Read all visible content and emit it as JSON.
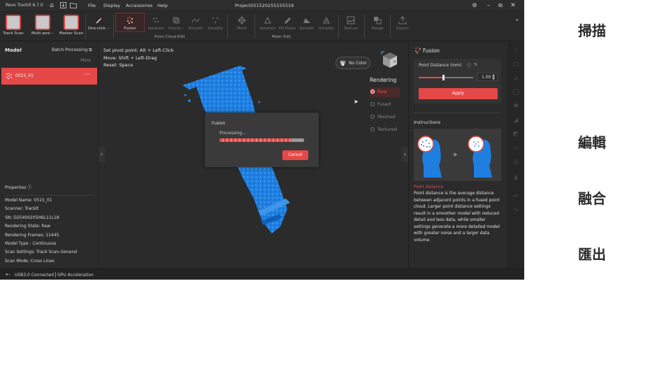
{
  "app": {
    "title": "Revo TrackIt 6.7.0",
    "project": "Project051520255155519"
  },
  "menu": [
    "File",
    "Display",
    "Accessories",
    "Help"
  ],
  "toolbar": {
    "buttons": {
      "track_scan": "Track Scan",
      "multi_pos": "Multi-posi···",
      "marker_scan": "Marker Scan",
      "one_click": "One-click ···",
      "fusion": "Fusion",
      "isolation1": "Isolation",
      "overlap": "Overla···",
      "smooth1": "Smooth",
      "simplify1": "Simplify",
      "mesh": "Mesh",
      "isolation2": "Isolation",
      "fill_holes": "Fill Holes",
      "smooth2": "Smooth",
      "simplify2": "Simplify",
      "texture": "Texture",
      "merge": "Merge",
      "export": "Export"
    },
    "groups": {
      "point_cloud_edit": "Point Cloud Edit",
      "mesh_edit": "Mesh Edit"
    }
  },
  "left_panel": {
    "title": "Model",
    "batch": "Batch Processing",
    "more": "More",
    "model_name": "0515_01",
    "properties_title": "Properties",
    "properties": [
      "Model Name:  0515_01",
      "Scanner:  TrackIt",
      "SN:  D25400205H6L11L18",
      "Rendering State:  Raw",
      "Rendering Frames:  11445",
      "Model Type :  Continuous",
      "Scan Settings:  Track Scan-General",
      "Scan Mode:  Cross Lines"
    ]
  },
  "viewport": {
    "hints": [
      "Set pivot point:  Alt + Left-Click",
      "Move:  Shift + Left-Drag",
      "Reset:  Space"
    ],
    "no_color": "No Color",
    "rendering_title": "Rendering",
    "rendering_options": [
      "Raw",
      "Fused",
      "Meshed",
      "Textured"
    ],
    "rendering_selected": "Raw"
  },
  "dialog": {
    "title": "Fusion",
    "status": "Processing...",
    "progress": 0.85,
    "cancel": "Cancel"
  },
  "right_panel": {
    "title": "Fusion",
    "point_distance_label": "Point Distance (mm)",
    "point_distance_value": "1.00",
    "slider_fraction": 0.45,
    "apply": "Apply",
    "instructions_title": "Instructions",
    "pd_heading": "Point distance",
    "pd_text": "Point distance is the average distance between adjacent points in a fused point cloud. Larger point distance settings result in a smoother model with reduced detail and less data, while smaller settings generate a more detailed model with greater noise and a larger data volume."
  },
  "status_bar": {
    "usb": "USB3.0 Connected",
    "gpu": "GPU Acceleration"
  },
  "side_labels": [
    "掃描",
    "編輯",
    "融合",
    "匯出"
  ],
  "colors": {
    "accent": "#e64848",
    "background": "#2b2b2b",
    "model_blue": "#1e7fe0"
  }
}
